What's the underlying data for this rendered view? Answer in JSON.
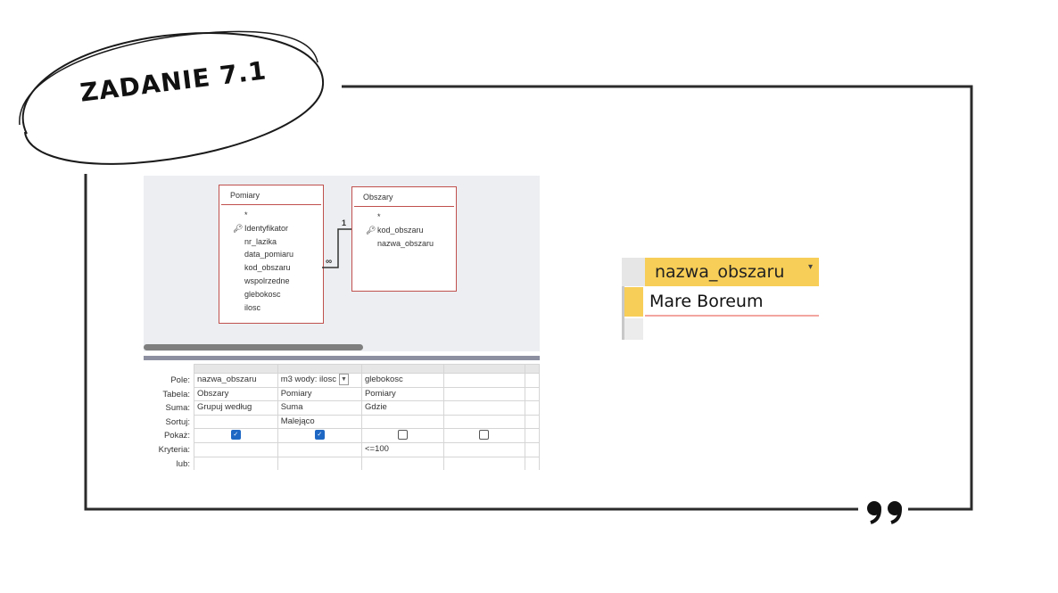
{
  "badge": {
    "title": "ZADANIE 7.1"
  },
  "designer": {
    "tables": [
      {
        "name": "Pomiary",
        "fields": [
          "*",
          "Identyfikator",
          "nr_lazika",
          "data_pomiaru",
          "kod_obszaru",
          "wspolrzedne",
          "glebokosc",
          "ilosc"
        ],
        "key_field": "Identyfikator"
      },
      {
        "name": "Obszary",
        "fields": [
          "*",
          "kod_obszaru",
          "nazwa_obszaru"
        ],
        "key_field": "kod_obszaru"
      }
    ],
    "relationship": {
      "one_label": "1",
      "many_label": "∞"
    },
    "grid": {
      "row_labels": [
        "Pole:",
        "Tabela:",
        "Suma:",
        "Sortuj:",
        "Pokaż:",
        "Kryteria:",
        "lub:"
      ],
      "columns": [
        {
          "pole": "nazwa_obszaru",
          "tabela": "Obszary",
          "suma": "Grupuj według",
          "sortuj": "",
          "pokaz": true,
          "kryteria": "",
          "lub": ""
        },
        {
          "pole": "m3 wody: ilosc",
          "tabela": "Pomiary",
          "suma": "Suma",
          "sortuj": "Malejąco",
          "pokaz": true,
          "kryteria": "",
          "lub": "",
          "has_dropdown": true
        },
        {
          "pole": "glebokosc",
          "tabela": "Pomiary",
          "suma": "Gdzie",
          "sortuj": "",
          "pokaz": false,
          "kryteria": "<=100",
          "lub": ""
        },
        {
          "pole": "",
          "tabela": "",
          "suma": "",
          "sortuj": "",
          "pokaz": false,
          "kryteria": "",
          "lub": ""
        }
      ]
    }
  },
  "result": {
    "column_header": "nazwa_obszaru",
    "rows": [
      "Mare Boreum"
    ]
  },
  "colors": {
    "header_yellow": "#f7ce57",
    "table_border": "#c0504d",
    "checkbox_blue": "#1e68c4"
  },
  "icons": {
    "quote": "quote-icon",
    "key": "key-icon",
    "dropdown": "chevron-down-icon"
  }
}
